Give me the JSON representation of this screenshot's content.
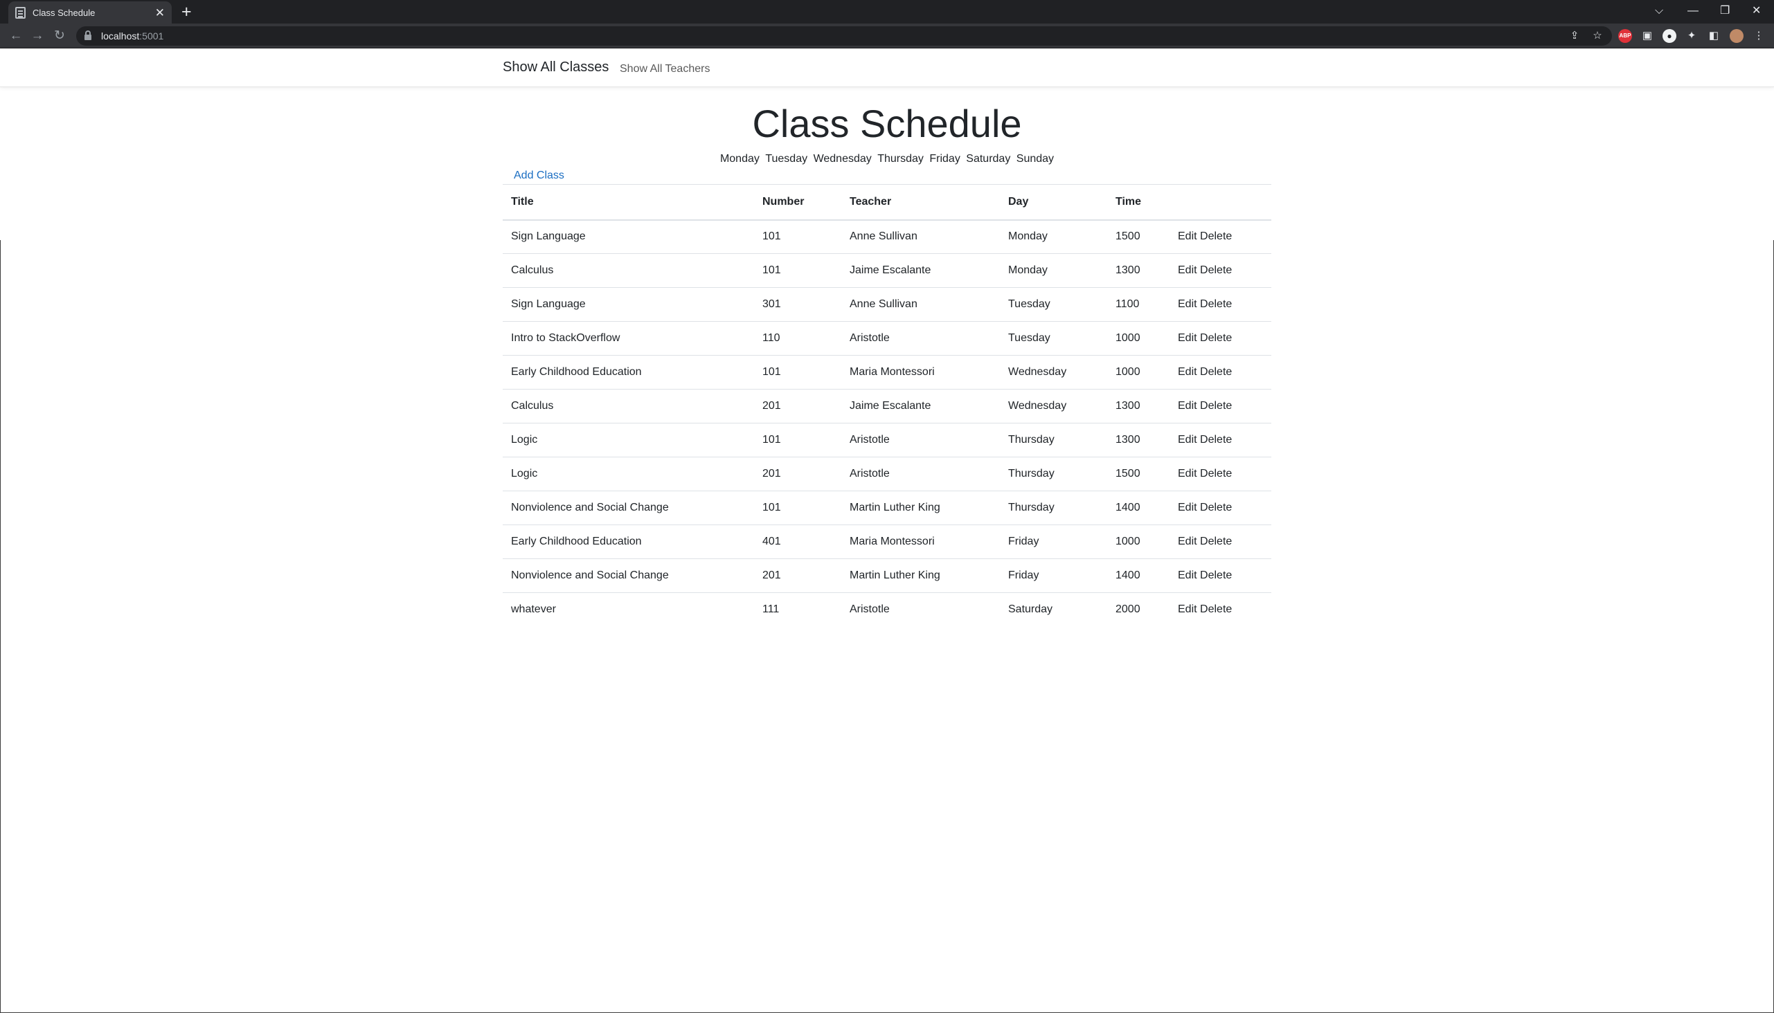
{
  "browser": {
    "tab_title": "Class Schedule",
    "url_host": "localhost",
    "url_port": ":5001",
    "extension_abp_label": "ABP"
  },
  "site_nav": {
    "brand": "Show All Classes",
    "teachers_link": "Show All Teachers"
  },
  "page": {
    "title": "Class Schedule",
    "days": [
      "Monday",
      "Tuesday",
      "Wednesday",
      "Thursday",
      "Friday",
      "Saturday",
      "Sunday"
    ],
    "add_class": "Add Class"
  },
  "table": {
    "headers": [
      "Title",
      "Number",
      "Teacher",
      "Day",
      "Time",
      ""
    ],
    "edit_label": "Edit",
    "delete_label": "Delete",
    "rows": [
      [
        "Sign Language",
        "101",
        "Anne Sullivan",
        "Monday",
        "1500"
      ],
      [
        "Calculus",
        "101",
        "Jaime Escalante",
        "Monday",
        "1300"
      ],
      [
        "Sign Language",
        "301",
        "Anne Sullivan",
        "Tuesday",
        "1100"
      ],
      [
        "Intro to StackOverflow",
        "110",
        "Aristotle",
        "Tuesday",
        "1000"
      ],
      [
        "Early Childhood Education",
        "101",
        "Maria Montessori",
        "Wednesday",
        "1000"
      ],
      [
        "Calculus",
        "201",
        "Jaime Escalante",
        "Wednesday",
        "1300"
      ],
      [
        "Logic",
        "101",
        "Aristotle",
        "Thursday",
        "1300"
      ],
      [
        "Logic",
        "201",
        "Aristotle",
        "Thursday",
        "1500"
      ],
      [
        "Nonviolence and Social Change",
        "101",
        "Martin Luther King",
        "Thursday",
        "1400"
      ],
      [
        "Early Childhood Education",
        "401",
        "Maria Montessori",
        "Friday",
        "1000"
      ],
      [
        "Nonviolence and Social Change",
        "201",
        "Martin Luther King",
        "Friday",
        "1400"
      ],
      [
        "whatever",
        "111",
        "Aristotle",
        "Saturday",
        "2000"
      ]
    ]
  },
  "colors": {
    "chrome_dark": "#202124",
    "chrome_toolbar": "#35363a",
    "link_blue": "#1b6ec2",
    "text": "#212529"
  }
}
